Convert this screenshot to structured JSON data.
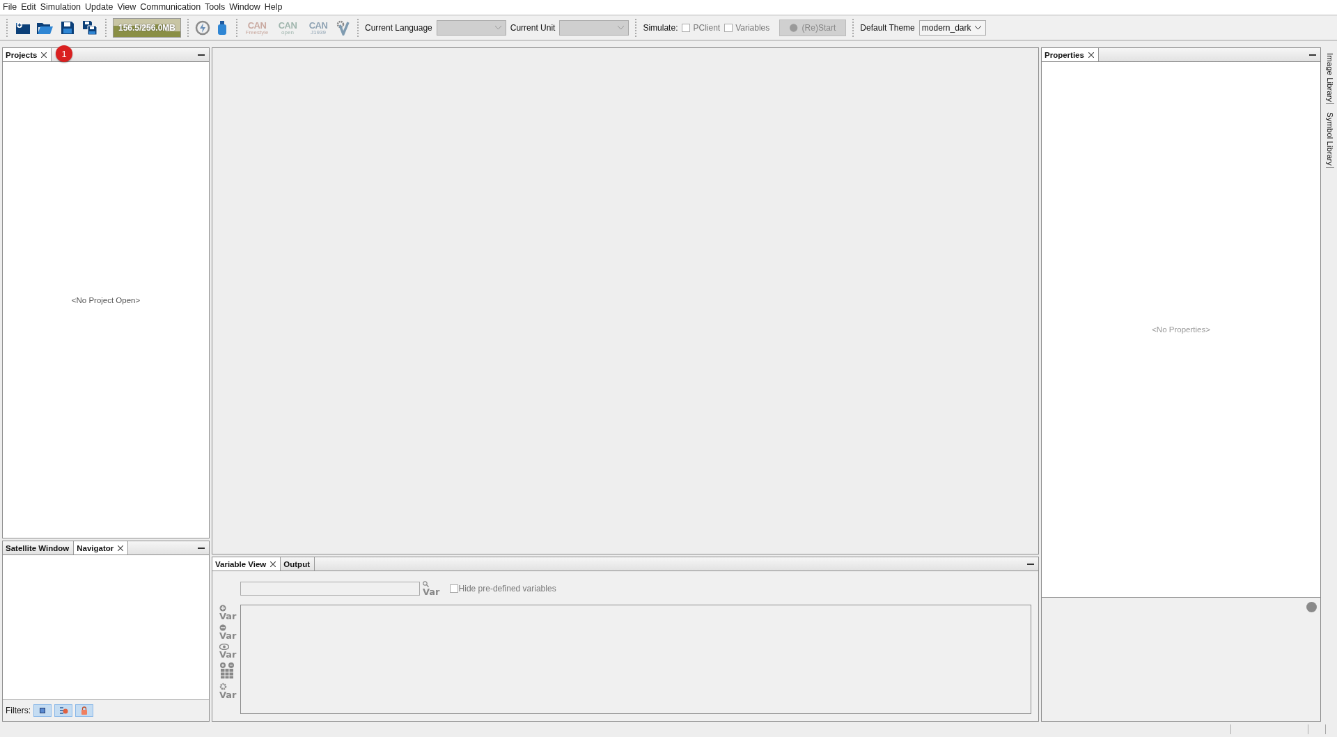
{
  "menu": [
    "File",
    "Edit",
    "Simulation",
    "Update",
    "View",
    "Communication",
    "Tools",
    "Window",
    "Help"
  ],
  "toolbar": {
    "memory": "156.5/256.0MB",
    "can_buttons": [
      {
        "label": "CAN",
        "sub": "Freestyle",
        "color": "#c9a9a0"
      },
      {
        "label": "CAN",
        "sub": "open",
        "color": "#9fb5ad"
      },
      {
        "label": "CAN",
        "sub": "J1939",
        "color": "#8ea2b3"
      }
    ],
    "language": {
      "label": "Current Language"
    },
    "unit": {
      "label": "Current Unit"
    },
    "simulate": {
      "label": "Simulate:",
      "options": [
        {
          "label": "PClient",
          "checked": false
        },
        {
          "label": "Variables",
          "checked": false
        }
      ],
      "restart": {
        "label": "(Re)Start",
        "disabled": true
      }
    },
    "theme": {
      "label": "Default Theme",
      "value": "modern_dark"
    }
  },
  "annotation_badge": "1",
  "projects_panel": {
    "tabs": [
      {
        "label": "Projects",
        "selected": true,
        "closable": true
      }
    ],
    "empty_text": "<No Project Open>"
  },
  "bottom_left_panel": {
    "tabs": [
      {
        "label": "Satellite Window",
        "selected": false,
        "closable": false
      },
      {
        "label": "Navigator",
        "selected": true,
        "closable": true
      }
    ],
    "filters_label": "Filters:"
  },
  "variable_panel": {
    "tabs": [
      {
        "label": "Variable View",
        "selected": true,
        "closable": true
      },
      {
        "label": "Output",
        "selected": false,
        "closable": false
      }
    ],
    "search_icon_label": "Var",
    "hide_predefined": {
      "label": "Hide pre-defined variables",
      "checked": false
    },
    "tools": [
      {
        "kind": "add",
        "label": "Var"
      },
      {
        "kind": "remove",
        "label": "Var"
      },
      {
        "kind": "watch",
        "label": "Var"
      },
      {
        "kind": "table"
      },
      {
        "kind": "settings",
        "label": "Var"
      }
    ]
  },
  "properties_panel": {
    "tabs": [
      {
        "label": "Properties",
        "selected": true,
        "closable": true
      }
    ],
    "empty_text": "<No Properties>"
  },
  "side_tabs": [
    "Image Library",
    "Symbol Library"
  ]
}
